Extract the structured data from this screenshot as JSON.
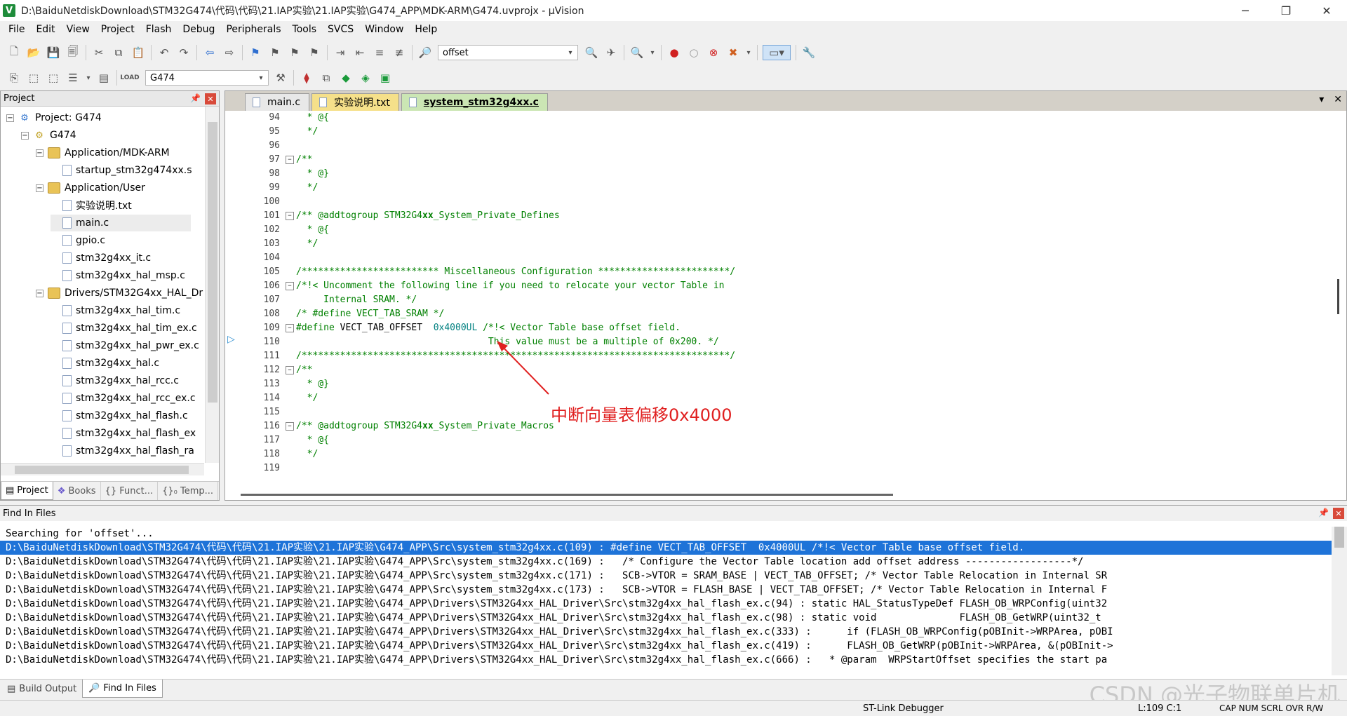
{
  "window": {
    "title": "D:\\BaiduNetdiskDownload\\STM32G474\\代码\\代码\\21.IAP实验\\21.IAP实验\\G474_APP\\MDK-ARM\\G474.uvprojx - µVision",
    "minimize": "─",
    "maximize": "❐",
    "close": "✕"
  },
  "menu": [
    "File",
    "Edit",
    "View",
    "Project",
    "Flash",
    "Debug",
    "Peripherals",
    "Tools",
    "SVCS",
    "Window",
    "Help"
  ],
  "toolbar1": {
    "find_value": "offset"
  },
  "toolbar2": {
    "target_value": "G474"
  },
  "project_panel": {
    "title": "Project",
    "tree": [
      {
        "label": "Project: G474",
        "level": 0,
        "type": "project",
        "expand": "−"
      },
      {
        "label": "G474",
        "level": 1,
        "type": "target",
        "expand": "−"
      },
      {
        "label": "Application/MDK-ARM",
        "level": 2,
        "type": "folder",
        "expand": "−"
      },
      {
        "label": "startup_stm32g474xx.s",
        "level": 3,
        "type": "file"
      },
      {
        "label": "Application/User",
        "level": 2,
        "type": "folder",
        "expand": "−"
      },
      {
        "label": "实验说明.txt",
        "level": 3,
        "type": "file"
      },
      {
        "label": "main.c",
        "level": 3,
        "type": "file"
      },
      {
        "label": "gpio.c",
        "level": 3,
        "type": "file"
      },
      {
        "label": "stm32g4xx_it.c",
        "level": 3,
        "type": "file"
      },
      {
        "label": "stm32g4xx_hal_msp.c",
        "level": 3,
        "type": "file"
      },
      {
        "label": "Drivers/STM32G4xx_HAL_Dr",
        "level": 2,
        "type": "folder",
        "expand": "−"
      },
      {
        "label": "stm32g4xx_hal_tim.c",
        "level": 3,
        "type": "file"
      },
      {
        "label": "stm32g4xx_hal_tim_ex.c",
        "level": 3,
        "type": "file"
      },
      {
        "label": "stm32g4xx_hal_pwr_ex.c",
        "level": 3,
        "type": "file"
      },
      {
        "label": "stm32g4xx_hal.c",
        "level": 3,
        "type": "file"
      },
      {
        "label": "stm32g4xx_hal_rcc.c",
        "level": 3,
        "type": "file"
      },
      {
        "label": "stm32g4xx_hal_rcc_ex.c",
        "level": 3,
        "type": "file"
      },
      {
        "label": "stm32g4xx_hal_flash.c",
        "level": 3,
        "type": "file"
      },
      {
        "label": "stm32g4xx_hal_flash_ex",
        "level": 3,
        "type": "file"
      },
      {
        "label": "stm32g4xx_hal_flash_ra",
        "level": 3,
        "type": "file"
      }
    ],
    "tabs": [
      "Project",
      "Books",
      "{} Funct...",
      "{}₀ Temp..."
    ]
  },
  "editor": {
    "tabs": [
      {
        "label": "main.c",
        "style": "normal"
      },
      {
        "label": "实验说明.txt",
        "style": "yellow"
      },
      {
        "label": "system_stm32g4xx.c",
        "style": "active"
      }
    ],
    "lines": [
      {
        "n": "94",
        "fold": "",
        "segs": [
          [
            "cm",
            "  * @{"
          ]
        ]
      },
      {
        "n": "95",
        "fold": "",
        "segs": [
          [
            "cm",
            "  */"
          ]
        ]
      },
      {
        "n": "96",
        "fold": "",
        "segs": []
      },
      {
        "n": "97",
        "fold": "−",
        "segs": [
          [
            "cm",
            "/**"
          ]
        ]
      },
      {
        "n": "98",
        "fold": "",
        "segs": [
          [
            "cm",
            "  * @}"
          ]
        ]
      },
      {
        "n": "99",
        "fold": "",
        "segs": [
          [
            "cm",
            "  */"
          ]
        ]
      },
      {
        "n": "100",
        "fold": "",
        "segs": []
      },
      {
        "n": "101",
        "fold": "−",
        "segs": [
          [
            "cm",
            "/** @addtogroup STM32G4"
          ],
          [
            "idn",
            "xx"
          ],
          [
            "cm",
            "_System_Private_Defines"
          ]
        ]
      },
      {
        "n": "102",
        "fold": "",
        "segs": [
          [
            "cm",
            "  * @{"
          ]
        ]
      },
      {
        "n": "103",
        "fold": "",
        "segs": [
          [
            "cm",
            "  */"
          ]
        ]
      },
      {
        "n": "104",
        "fold": "",
        "segs": []
      },
      {
        "n": "105",
        "fold": "",
        "segs": [
          [
            "cm",
            "/************************* Miscellaneous Configuration ************************/"
          ]
        ]
      },
      {
        "n": "106",
        "fold": "−",
        "segs": [
          [
            "cm",
            "/*!< Uncomment the following line if you need to relocate your vector Table in"
          ]
        ]
      },
      {
        "n": "107",
        "fold": "",
        "segs": [
          [
            "cm",
            "     Internal SRAM. */"
          ]
        ]
      },
      {
        "n": "108",
        "fold": "",
        "segs": [
          [
            "cm",
            "/* #define VECT_TAB_SRAM */"
          ]
        ]
      },
      {
        "n": "109",
        "fold": "−",
        "segs": [
          [
            "pp",
            "#define "
          ],
          [
            "",
            "VECT_TAB_OFFSET  "
          ],
          [
            "num",
            "0x4000UL"
          ],
          [
            "cm",
            " /*!< Vector Table base offset field."
          ]
        ]
      },
      {
        "n": "110",
        "fold": "",
        "segs": [
          [
            "cm",
            "                                   This value must be a multiple of 0x200. */"
          ]
        ]
      },
      {
        "n": "111",
        "fold": "",
        "segs": [
          [
            "cm",
            "/******************************************************************************/"
          ]
        ]
      },
      {
        "n": "112",
        "fold": "−",
        "segs": [
          [
            "cm",
            "/**"
          ]
        ]
      },
      {
        "n": "113",
        "fold": "",
        "segs": [
          [
            "cm",
            "  * @}"
          ]
        ]
      },
      {
        "n": "114",
        "fold": "",
        "segs": [
          [
            "cm",
            "  */"
          ]
        ]
      },
      {
        "n": "115",
        "fold": "",
        "segs": []
      },
      {
        "n": "116",
        "fold": "−",
        "segs": [
          [
            "cm",
            "/** @addtogroup STM32G4"
          ],
          [
            "idn",
            "xx"
          ],
          [
            "cm",
            "_System_Private_Macros"
          ]
        ]
      },
      {
        "n": "117",
        "fold": "",
        "segs": [
          [
            "cm",
            "  * @{"
          ]
        ]
      },
      {
        "n": "118",
        "fold": "",
        "segs": [
          [
            "cm",
            "  */"
          ]
        ]
      },
      {
        "n": "119",
        "fold": "",
        "segs": []
      }
    ],
    "annotation": "中断向量表偏移0x4000"
  },
  "find_panel": {
    "title": "Find In Files",
    "lines": [
      "Searching for 'offset'...",
      "D:\\BaiduNetdiskDownload\\STM32G474\\代码\\代码\\21.IAP实验\\21.IAP实验\\G474_APP\\Src\\system_stm32g4xx.c(109) : #define VECT_TAB_OFFSET  0x4000UL /*!< Vector Table base offset field.",
      "D:\\BaiduNetdiskDownload\\STM32G474\\代码\\代码\\21.IAP实验\\21.IAP实验\\G474_APP\\Src\\system_stm32g4xx.c(169) :   /* Configure the Vector Table location add offset address ------------------*/",
      "D:\\BaiduNetdiskDownload\\STM32G474\\代码\\代码\\21.IAP实验\\21.IAP实验\\G474_APP\\Src\\system_stm32g4xx.c(171) :   SCB->VTOR = SRAM_BASE | VECT_TAB_OFFSET; /* Vector Table Relocation in Internal SR",
      "D:\\BaiduNetdiskDownload\\STM32G474\\代码\\代码\\21.IAP实验\\21.IAP实验\\G474_APP\\Src\\system_stm32g4xx.c(173) :   SCB->VTOR = FLASH_BASE | VECT_TAB_OFFSET; /* Vector Table Relocation in Internal F",
      "D:\\BaiduNetdiskDownload\\STM32G474\\代码\\代码\\21.IAP实验\\21.IAP实验\\G474_APP\\Drivers\\STM32G4xx_HAL_Driver\\Src\\stm32g4xx_hal_flash_ex.c(94) : static HAL_StatusTypeDef FLASH_OB_WRPConfig(uint32",
      "D:\\BaiduNetdiskDownload\\STM32G474\\代码\\代码\\21.IAP实验\\21.IAP实验\\G474_APP\\Drivers\\STM32G4xx_HAL_Driver\\Src\\stm32g4xx_hal_flash_ex.c(98) : static void              FLASH_OB_GetWRP(uint32_t",
      "D:\\BaiduNetdiskDownload\\STM32G474\\代码\\代码\\21.IAP实验\\21.IAP实验\\G474_APP\\Drivers\\STM32G4xx_HAL_Driver\\Src\\stm32g4xx_hal_flash_ex.c(333) :      if (FLASH_OB_WRPConfig(pOBInit->WRPArea, pOBI",
      "D:\\BaiduNetdiskDownload\\STM32G474\\代码\\代码\\21.IAP实验\\21.IAP实验\\G474_APP\\Drivers\\STM32G4xx_HAL_Driver\\Src\\stm32g4xx_hal_flash_ex.c(419) :      FLASH_OB_GetWRP(pOBInit->WRPArea, &(pOBInit->",
      "D:\\BaiduNetdiskDownload\\STM32G474\\代码\\代码\\21.IAP实验\\21.IAP实验\\G474_APP\\Drivers\\STM32G4xx_HAL_Driver\\Src\\stm32g4xx_hal_flash_ex.c(666) :   * @param  WRPStartOffset specifies the start pa"
    ],
    "selected_index": 1
  },
  "bottom_tabs": [
    "Build Output",
    "Find In Files"
  ],
  "status": {
    "debugger": "ST-Link Debugger",
    "position": "L:109 C:1",
    "flags": "CAP  NUM  SCRL  OVR  R/W"
  },
  "watermark": "CSDN @光子物联单片机"
}
